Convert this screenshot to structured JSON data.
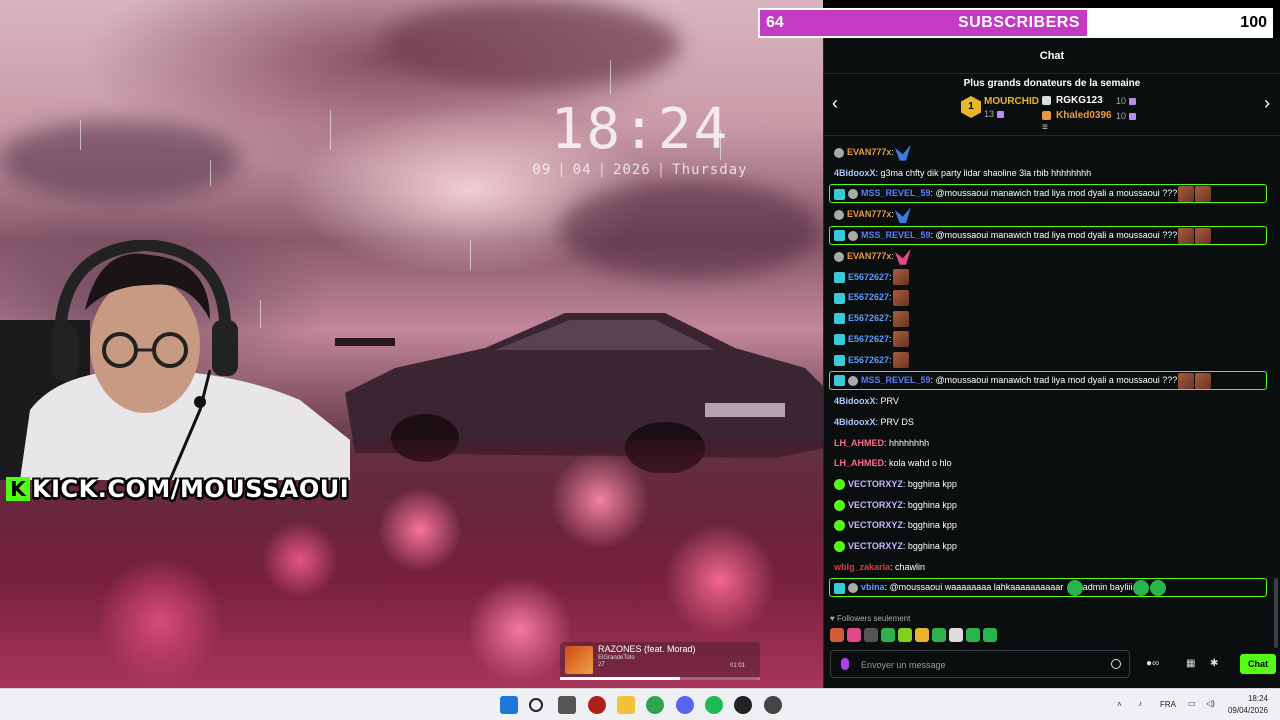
{
  "subscriber_goal": {
    "current": "64",
    "label": "SUBSCRIBERS",
    "target": "100",
    "progress_fraction": 0.64,
    "fill_color": "#c23bc2"
  },
  "overlay": {
    "clock_time": "18:24",
    "date_parts": [
      "09",
      "04",
      "2026",
      "Thursday"
    ],
    "kick_url": "KICK.COM/MOUSSAOUI",
    "now_playing": {
      "title": "RAZONES (feat. Morad)",
      "artist": "ElGrandeToto",
      "number": "27",
      "time": "01:01",
      "progress_fraction": 0.6
    }
  },
  "chat": {
    "header": "Chat",
    "donors_title": "Plus grands donateurs de la semaine",
    "donors": [
      {
        "name": "MOURCHID",
        "value": "13",
        "color": "#e8b62a"
      },
      {
        "name": "RGKG123",
        "value": "10",
        "color": "#ffffff"
      },
      {
        "name": "Khaled0396",
        "value": "10",
        "color": "#e89a3c"
      }
    ],
    "messages": [
      {
        "user": "EVAN777x",
        "sep": ":",
        "text": "",
        "color": "#e89a3c",
        "badges": [
          "mod"
        ],
        "emotes": [
          "blue"
        ],
        "highlight": false
      },
      {
        "user": "4BidooxX",
        "sep": ":",
        "text": " g3ma chfty dik party lidar shaoline 3la rbib hhhhhhhh",
        "color": "#a8c8ff",
        "badges": [],
        "emotes": [],
        "highlight": false
      },
      {
        "user": "MSS_REVEL_59",
        "sep": ":",
        "text": " @moussaoui manawich trad liya mod dyali a moussaoui ???",
        "color": "#5a7dff",
        "badges": [
          "sub",
          "mod"
        ],
        "emotes": [
          "face",
          "face"
        ],
        "highlight": true
      },
      {
        "user": "EVAN777x",
        "sep": ":",
        "text": "",
        "color": "#e89a3c",
        "badges": [
          "mod"
        ],
        "emotes": [
          "blue"
        ],
        "highlight": false
      },
      {
        "user": "MSS_REVEL_59",
        "sep": ":",
        "text": " @moussaoui manawich trad liya mod dyali a moussaoui ???",
        "color": "#5a7dff",
        "badges": [
          "sub",
          "mod"
        ],
        "emotes": [
          "face",
          "face"
        ],
        "highlight": true
      },
      {
        "user": "EVAN777x",
        "sep": ":",
        "text": "",
        "color": "#e89a3c",
        "badges": [
          "mod"
        ],
        "emotes": [
          "pink"
        ],
        "highlight": false
      },
      {
        "user": "E5672627",
        "sep": ":",
        "text": "",
        "color": "#5a9cff",
        "badges": [
          "sub"
        ],
        "emotes": [
          "face"
        ],
        "highlight": false
      },
      {
        "user": "E5672627",
        "sep": ":",
        "text": "",
        "color": "#5a9cff",
        "badges": [
          "sub"
        ],
        "emotes": [
          "face"
        ],
        "highlight": false
      },
      {
        "user": "E5672627",
        "sep": ":",
        "text": "",
        "color": "#5a9cff",
        "badges": [
          "sub"
        ],
        "emotes": [
          "face"
        ],
        "highlight": false
      },
      {
        "user": "E5672627",
        "sep": ":",
        "text": "",
        "color": "#5a9cff",
        "badges": [
          "sub"
        ],
        "emotes": [
          "face"
        ],
        "highlight": false
      },
      {
        "user": "E5672627",
        "sep": ":",
        "text": "",
        "color": "#5a9cff",
        "badges": [
          "sub"
        ],
        "emotes": [
          "face"
        ],
        "highlight": false
      },
      {
        "user": "MSS_REVEL_59",
        "sep": ":",
        "text": " @moussaoui manawich trad liya mod dyali a moussaoui ???",
        "color": "#5a7dff",
        "badges": [
          "sub",
          "mod"
        ],
        "emotes": [
          "face",
          "face"
        ],
        "highlight": true
      },
      {
        "user": "4BidooxX",
        "sep": ":",
        "text": " PRV",
        "color": "#a8c8ff",
        "badges": [],
        "emotes": [],
        "highlight": false
      },
      {
        "user": "4BidooxX",
        "sep": ":",
        "text": " PRV DS",
        "color": "#a8c8ff",
        "badges": [],
        "emotes": [],
        "highlight": false
      },
      {
        "user": "LH_AHMED",
        "sep": ":",
        "text": " hhhhhhhh",
        "color": "#ff6b8b",
        "badges": [],
        "emotes": [],
        "highlight": false
      },
      {
        "user": "LH_AHMED",
        "sep": ":",
        "text": " kola wahd o hlo",
        "color": "#ff6b8b",
        "badges": [],
        "emotes": [],
        "highlight": false
      },
      {
        "user": "VECTORXYZ",
        "sep": ":",
        "text": " bgghina kpp",
        "color": "#c8b6ff",
        "badges": [
          "verified"
        ],
        "emotes": [],
        "highlight": false
      },
      {
        "user": "VECTORXYZ",
        "sep": ":",
        "text": " bgghina kpp",
        "color": "#c8b6ff",
        "badges": [
          "verified"
        ],
        "emotes": [],
        "highlight": false
      },
      {
        "user": "VECTORXYZ",
        "sep": ":",
        "text": " bgghina kpp",
        "color": "#c8b6ff",
        "badges": [
          "verified"
        ],
        "emotes": [],
        "highlight": false
      },
      {
        "user": "VECTORXYZ",
        "sep": ":",
        "text": " bgghina kpp",
        "color": "#c8b6ff",
        "badges": [
          "verified"
        ],
        "emotes": [],
        "highlight": false
      },
      {
        "user": "wblg_zakaria",
        "sep": ":",
        "text": " chawlin",
        "color": "#e03a3a",
        "badges": [],
        "emotes": [],
        "highlight": false
      },
      {
        "user": "vbina",
        "sep": ":",
        "text": " @moussaoui waaaaaaaa lahkaaaaaaaaaar ",
        "color": "#5a9cff",
        "badges": [
          "sub",
          "mod"
        ],
        "emotes": [
          "green"
        ],
        "tail": "admin bayliii",
        "tail_emotes": [
          "green",
          "green"
        ],
        "highlight": true
      }
    ],
    "followers_label": "Followers seulement",
    "input_placeholder": "Envoyer un message",
    "send_label": "Chat"
  },
  "taskbar": {
    "language": "FRA",
    "time": "18:24",
    "date": "09/04/2026"
  }
}
